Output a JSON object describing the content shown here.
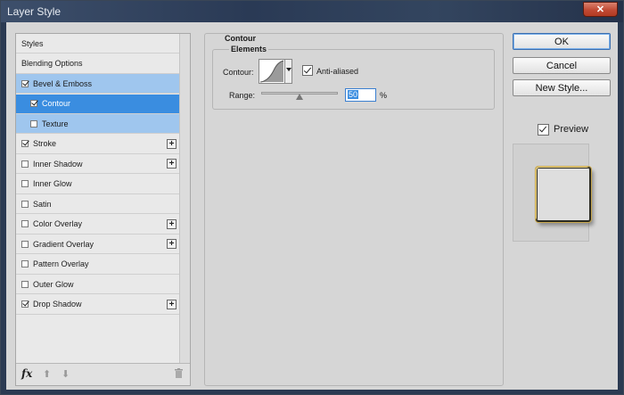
{
  "window": {
    "title": "Layer Style",
    "close_glyph": "✕"
  },
  "style_list": {
    "items": [
      {
        "label": "Styles",
        "has_checkbox": false,
        "checked": false,
        "plus": false,
        "state": ""
      },
      {
        "label": "Blending Options",
        "has_checkbox": false,
        "checked": false,
        "plus": false,
        "state": ""
      },
      {
        "label": "Bevel & Emboss",
        "has_checkbox": true,
        "checked": true,
        "plus": false,
        "state": "sel1"
      },
      {
        "label": "Contour",
        "has_checkbox": true,
        "checked": true,
        "plus": false,
        "state": "sel2",
        "indent": true
      },
      {
        "label": "Texture",
        "has_checkbox": true,
        "checked": false,
        "plus": false,
        "state": "sel3",
        "indent": true
      },
      {
        "label": "Stroke",
        "has_checkbox": true,
        "checked": true,
        "plus": true,
        "state": ""
      },
      {
        "label": "Inner Shadow",
        "has_checkbox": true,
        "checked": false,
        "plus": true,
        "state": ""
      },
      {
        "label": "Inner Glow",
        "has_checkbox": true,
        "checked": false,
        "plus": false,
        "state": ""
      },
      {
        "label": "Satin",
        "has_checkbox": true,
        "checked": false,
        "plus": false,
        "state": ""
      },
      {
        "label": "Color Overlay",
        "has_checkbox": true,
        "checked": false,
        "plus": true,
        "state": ""
      },
      {
        "label": "Gradient Overlay",
        "has_checkbox": true,
        "checked": false,
        "plus": true,
        "state": ""
      },
      {
        "label": "Pattern Overlay",
        "has_checkbox": true,
        "checked": false,
        "plus": false,
        "state": ""
      },
      {
        "label": "Outer Glow",
        "has_checkbox": true,
        "checked": false,
        "plus": false,
        "state": ""
      },
      {
        "label": "Drop Shadow",
        "has_checkbox": true,
        "checked": true,
        "plus": true,
        "state": ""
      }
    ],
    "footer": {
      "fx_label": "fx",
      "up_glyph": "⬆",
      "down_glyph": "⬇"
    }
  },
  "contour_panel": {
    "section_title": "Contour",
    "group_title": "Elements",
    "contour_label": "Contour:",
    "anti_aliased_label": "Anti-aliased",
    "anti_aliased_checked": true,
    "range_label": "Range:",
    "range_value": "50",
    "range_unit": "%",
    "range_fraction": 0.5
  },
  "buttons": {
    "ok": "OK",
    "cancel": "Cancel",
    "new_style": "New Style..."
  },
  "preview": {
    "label": "Preview",
    "checked": true
  },
  "colors": {
    "selection_light": "#9fc6ee",
    "selection_dark": "#3a8de0",
    "close": "#c14a34"
  }
}
